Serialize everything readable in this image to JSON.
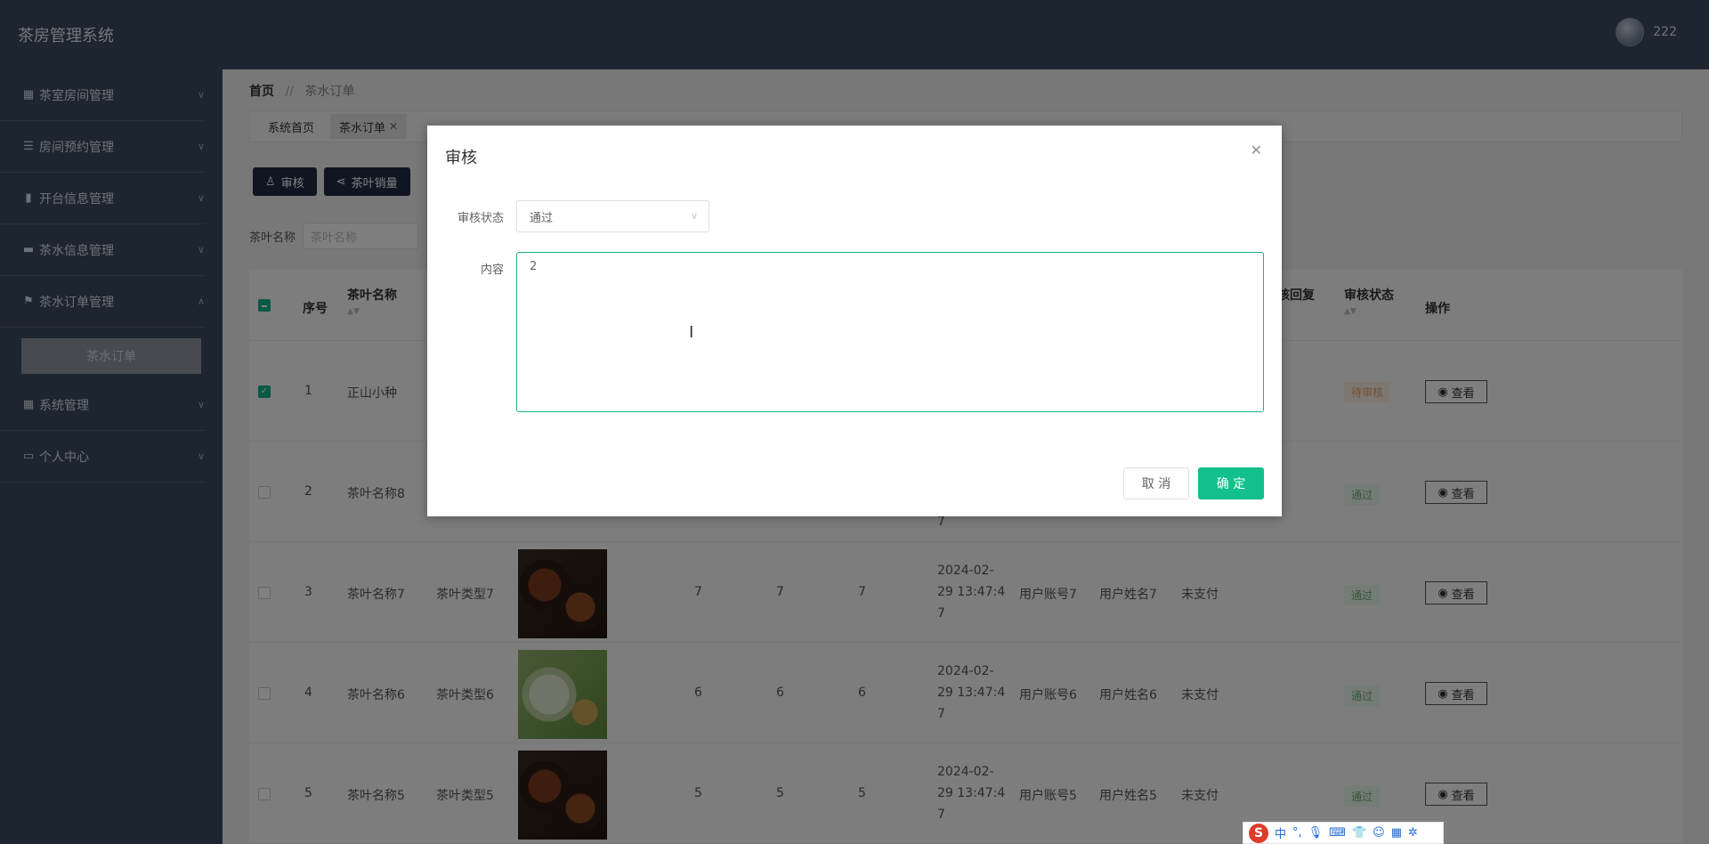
{
  "app": {
    "title": "茶房管理系统"
  },
  "user": {
    "name": "222"
  },
  "sidebar": {
    "items": [
      {
        "label": "茶室房间管理",
        "icon": "grid-icon"
      },
      {
        "label": "房间预约管理",
        "icon": "list-icon"
      },
      {
        "label": "开台信息管理",
        "icon": "bar-chart-icon"
      },
      {
        "label": "茶水信息管理",
        "icon": "printer-icon"
      },
      {
        "label": "茶水订单管理",
        "icon": "flag-icon",
        "expanded": true
      },
      {
        "label": "系统管理",
        "icon": "grid-icon"
      },
      {
        "label": "个人中心",
        "icon": "window-icon"
      }
    ],
    "active_sub": "茶水订单"
  },
  "breadcrumb": {
    "home": "首页",
    "separator": "//",
    "current": "茶水订单"
  },
  "tabs": [
    {
      "label": "系统首页"
    },
    {
      "label": "茶水订单",
      "active": true
    }
  ],
  "toolbar": {
    "audit_label": "审核",
    "sales_label": "茶叶销量"
  },
  "search": {
    "label": "茶叶名称",
    "placeholder": "茶叶名称"
  },
  "table": {
    "headers": {
      "index": "序号",
      "name": "茶叶名称",
      "reply": "核回复",
      "status": "审核状态",
      "action": "操作"
    },
    "view_label": "查看",
    "rows": [
      {
        "index": "1",
        "name": "正山小种",
        "status": "待审核",
        "checked": true
      },
      {
        "index": "2",
        "name": "茶叶名称8",
        "type": "",
        "qty": "",
        "d1": "",
        "d2": "",
        "date1": "",
        "date2": "",
        "date3": "7",
        "account": "",
        "username": "",
        "pay": "",
        "status": "通过"
      },
      {
        "index": "3",
        "name": "茶叶名称7",
        "type": "茶叶类型7",
        "qty": "7",
        "d1": "7",
        "d2": "7",
        "date1": "2024-02-",
        "date2": "29 13:47:4",
        "date3": "7",
        "account": "用户账号7",
        "username": "用户姓名7",
        "pay": "未支付",
        "status": "通过"
      },
      {
        "index": "4",
        "name": "茶叶名称6",
        "type": "茶叶类型6",
        "qty": "6",
        "d1": "6",
        "d2": "6",
        "date1": "2024-02-",
        "date2": "29 13:47:4",
        "date3": "7",
        "account": "用户账号6",
        "username": "用户姓名6",
        "pay": "未支付",
        "status": "通过"
      },
      {
        "index": "5",
        "name": "茶叶名称5",
        "type": "茶叶类型5",
        "qty": "5",
        "d1": "5",
        "d2": "5",
        "date1": "2024-02-",
        "date2": "29 13:47:4",
        "date3": "7",
        "account": "用户账号5",
        "username": "用户姓名5",
        "pay": "未支付",
        "status": "通过"
      }
    ]
  },
  "dialog": {
    "title": "审核",
    "status_label": "审核状态",
    "status_value": "通过",
    "content_label": "内容",
    "content_value": "2",
    "cancel_label": "取 消",
    "ok_label": "确 定"
  },
  "ime": {
    "mode": "中"
  },
  "colors": {
    "header_bg": "#3a4a63",
    "accent": "#13c08b"
  }
}
